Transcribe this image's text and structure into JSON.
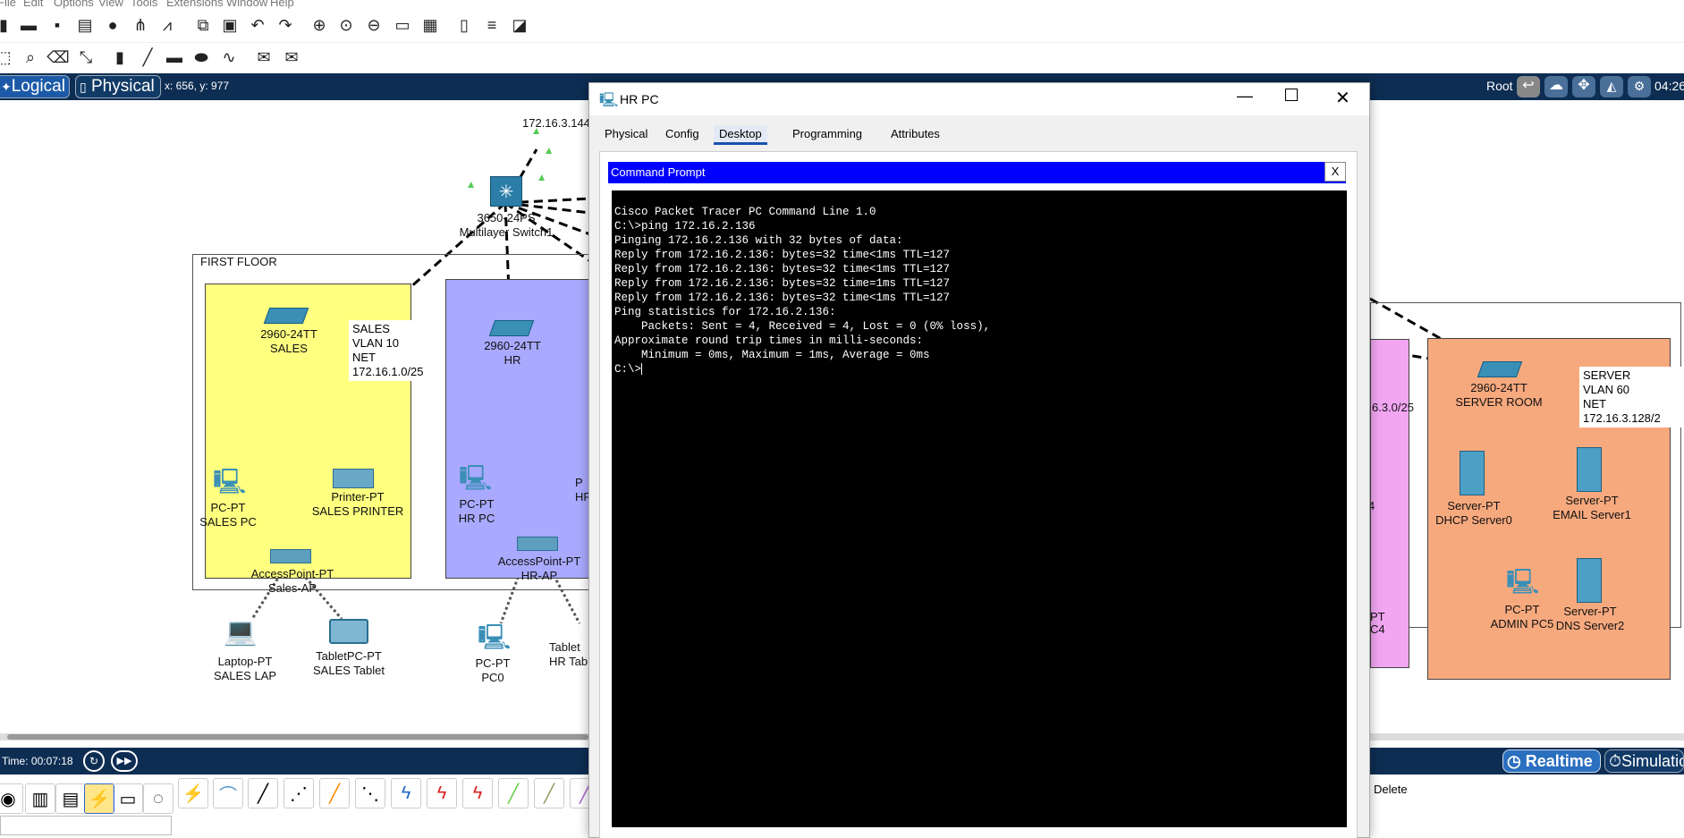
{
  "menu": {
    "items": [
      "File",
      "Edit",
      "Options",
      "View",
      "Tools",
      "Extensions",
      "Window",
      "Help"
    ]
  },
  "workbar": {
    "logical": "Logical",
    "physical": "Physical",
    "coords": "x: 656, y: 977",
    "root": "Root",
    "clock": "04:26"
  },
  "topology": {
    "ip_top": "172.16.3.144",
    "core_switch": {
      "model": "3650-24PS",
      "name": "Multilayer Switch1"
    },
    "first_floor": "FIRST FLOOR",
    "sales_switch": {
      "model": "2960-24TT",
      "name": "SALES"
    },
    "sales_note": [
      "SALES",
      "VLAN 10",
      "NET 172.16.1.0/25"
    ],
    "sales_pc": {
      "type": "PC-PT",
      "name": "SALES PC"
    },
    "sales_printer": {
      "type": "Printer-PT",
      "name": "SALES PRINTER"
    },
    "sales_ap": {
      "type": "AccessPoint-PT",
      "name": "Sales-AP"
    },
    "sales_laptop": {
      "type": "Laptop-PT",
      "name": "SALES LAP"
    },
    "sales_tablet": {
      "type": "TabletPC-PT",
      "name": "SALES Tablet"
    },
    "hr_switch": {
      "model": "2960-24TT",
      "name": "HR"
    },
    "hr_pc": {
      "type": "PC-PT",
      "name": "HR PC"
    },
    "hr_ap": {
      "type": "AccessPoint-PT",
      "name": "HR-AP"
    },
    "hr_pc0": {
      "type": "PC-PT",
      "name": "PC0"
    },
    "hr_tablet": {
      "type": "Tablet",
      "name": "HR Tab"
    },
    "hr_partial": {
      "type": "P",
      "name": "HF"
    },
    "pink_net": "6.3.0/25",
    "pink_4": "4",
    "pink_pt": "PT",
    "pink_c4": "C4",
    "server_switch": {
      "model": "2960-24TT",
      "name": "SERVER ROOM"
    },
    "server_note": [
      "SERVER",
      "VLAN 60",
      "NET 172.16.3.128/2"
    ],
    "dhcp": {
      "type": "Server-PT",
      "name": "DHCP Server0"
    },
    "email": {
      "type": "Server-PT",
      "name": "EMAIL Server1"
    },
    "admin_pc": {
      "type": "PC-PT",
      "name": "ADMIN PC5"
    },
    "dns": {
      "type": "Server-PT",
      "name": "DNS Server2"
    }
  },
  "status": {
    "time": "Time: 00:07:18",
    "realtime": "Realtime",
    "simulation": "Simulatio"
  },
  "devicebar": {
    "delete": "Delete"
  },
  "hr_window": {
    "title": "HR PC",
    "tabs": [
      "Physical",
      "Config",
      "Desktop",
      "Programming",
      "Attributes"
    ],
    "active_tab": "Desktop",
    "cmd_title": "Command Prompt",
    "cmd_close": "X",
    "terminal_lines": [
      "Cisco Packet Tracer PC Command Line 1.0",
      "C:\\>ping 172.16.2.136",
      "",
      "Pinging 172.16.2.136 with 32 bytes of data:",
      "",
      "Reply from 172.16.2.136: bytes=32 time<1ms TTL=127",
      "Reply from 172.16.2.136: bytes=32 time<1ms TTL=127",
      "Reply from 172.16.2.136: bytes=32 time=1ms TTL=127",
      "Reply from 172.16.2.136: bytes=32 time<1ms TTL=127",
      "",
      "Ping statistics for 172.16.2.136:",
      "    Packets: Sent = 4, Received = 4, Lost = 0 (0% loss),",
      "Approximate round trip times in milli-seconds:",
      "    Minimum = 0ms, Maximum = 1ms, Average = 0ms",
      "",
      "C:\\>"
    ]
  },
  "colors": {
    "workbar": "#0d2d52",
    "sales_area": "#ffff80",
    "hr_area": "#a9a9ff",
    "pink_area": "#f2a6f2",
    "server_area": "#f7a97e",
    "cmd_title": "#0000ff"
  }
}
